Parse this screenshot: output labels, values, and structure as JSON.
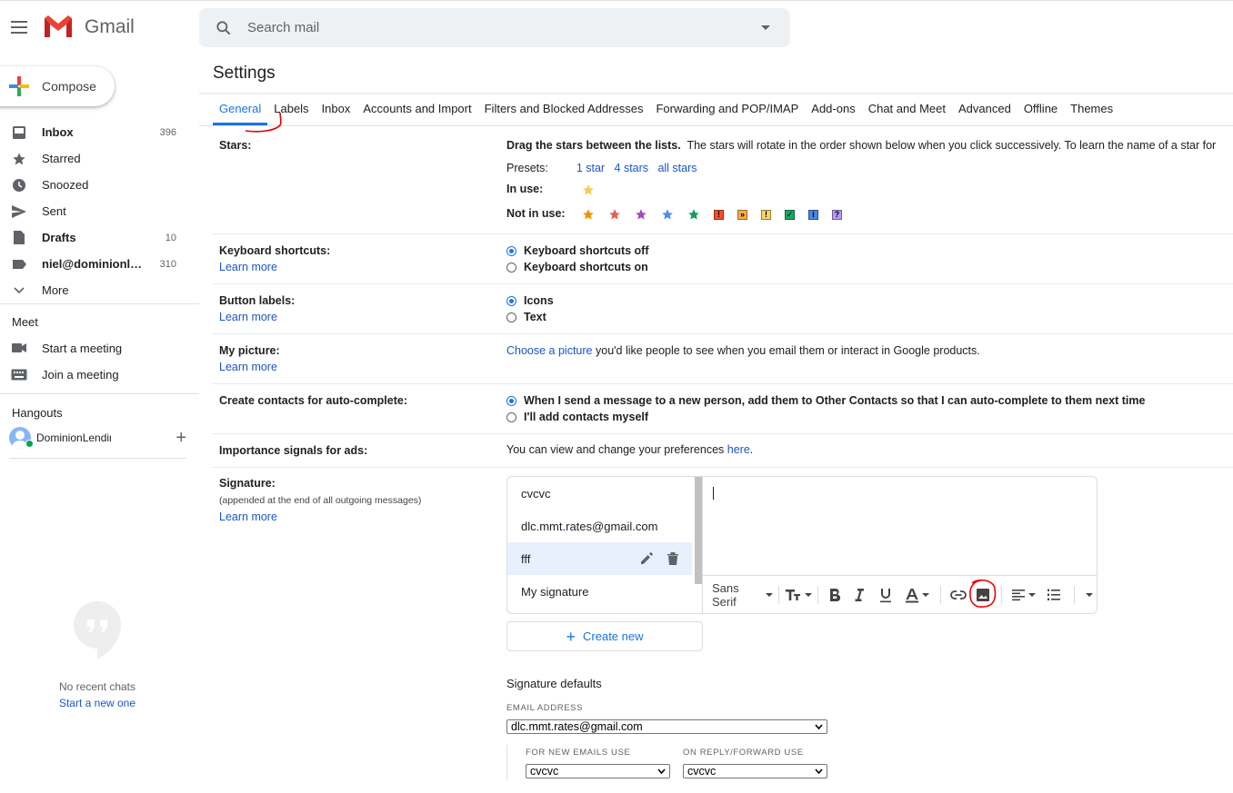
{
  "app": {
    "name": "Gmail"
  },
  "search": {
    "placeholder": "Search mail"
  },
  "compose": {
    "label": "Compose"
  },
  "nav": [
    {
      "label": "Inbox",
      "count": "396",
      "bold": true,
      "icon": "inbox-icon"
    },
    {
      "label": "Starred",
      "count": "",
      "bold": false,
      "icon": "star-icon"
    },
    {
      "label": "Snoozed",
      "count": "",
      "bold": false,
      "icon": "clock-icon"
    },
    {
      "label": "Sent",
      "count": "",
      "bold": false,
      "icon": "send-icon"
    },
    {
      "label": "Drafts",
      "count": "10",
      "bold": true,
      "icon": "draft-icon"
    },
    {
      "label": "niel@dominionlen...",
      "count": "310",
      "bold": true,
      "icon": "label-icon"
    },
    {
      "label": "More",
      "count": "",
      "bold": false,
      "icon": "chevron-down-icon"
    }
  ],
  "meet": {
    "title": "Meet",
    "start": "Start a meeting",
    "join": "Join a meeting"
  },
  "hangouts": {
    "title": "Hangouts",
    "user": "DominionLendir",
    "no_chats": "No recent chats",
    "start_new": "Start a new one"
  },
  "settings": {
    "title": "Settings"
  },
  "tabs": [
    "General",
    "Labels",
    "Inbox",
    "Accounts and Import",
    "Filters and Blocked Addresses",
    "Forwarding and POP/IMAP",
    "Add-ons",
    "Chat and Meet",
    "Advanced",
    "Offline",
    "Themes"
  ],
  "stars": {
    "label": "Stars:",
    "intro_bold": "Drag the stars between the lists.",
    "intro_rest": "The stars will rotate in the order shown below when you click successively. To learn the name of a star for",
    "presets_label": "Presets:",
    "presets": [
      "1 star",
      "4 stars",
      "all stars"
    ],
    "in_use_label": "In use:",
    "not_in_use_label": "Not in use:",
    "colors": {
      "yellow": "#f7cb4d",
      "orange": "#f09300",
      "red": "#e06055",
      "purple": "#ab47bc",
      "blue": "#4d90f0",
      "green": "#0f9d58"
    }
  },
  "keyboard": {
    "label": "Keyboard shortcuts:",
    "learn_more": "Learn more",
    "off": "Keyboard shortcuts off",
    "on": "Keyboard shortcuts on"
  },
  "buttons": {
    "label": "Button labels:",
    "learn_more": "Learn more",
    "icons": "Icons",
    "text": "Text"
  },
  "picture": {
    "label": "My picture:",
    "learn_more": "Learn more",
    "link": "Choose a picture",
    "rest": " you'd like people to see when you email them or interact in Google products."
  },
  "contacts": {
    "label": "Create contacts for auto-complete:",
    "opt1": "When I send a message to a new person, add them to Other Contacts so that I can auto-complete to them next time",
    "opt2": "I'll add contacts myself"
  },
  "importance": {
    "label": "Importance signals for ads:",
    "text": "You can view and change your preferences ",
    "link": "here",
    "end": "."
  },
  "signature": {
    "label": "Signature:",
    "sub": "(appended at the end of all outgoing messages)",
    "learn_more": "Learn more",
    "items": [
      "cvcvc",
      "dlc.mmt.rates@gmail.com",
      "fff",
      "My signature"
    ],
    "font": "Sans Serif",
    "create_new": "Create new",
    "defaults_title": "Signature defaults",
    "email_label": "EMAIL ADDRESS",
    "email_value": "dlc.mmt.rates@gmail.com",
    "new_label": "FOR NEW EMAILS USE",
    "new_value": "cvcvc",
    "reply_label": "ON REPLY/FORWARD USE",
    "reply_value": "cvcvc"
  }
}
